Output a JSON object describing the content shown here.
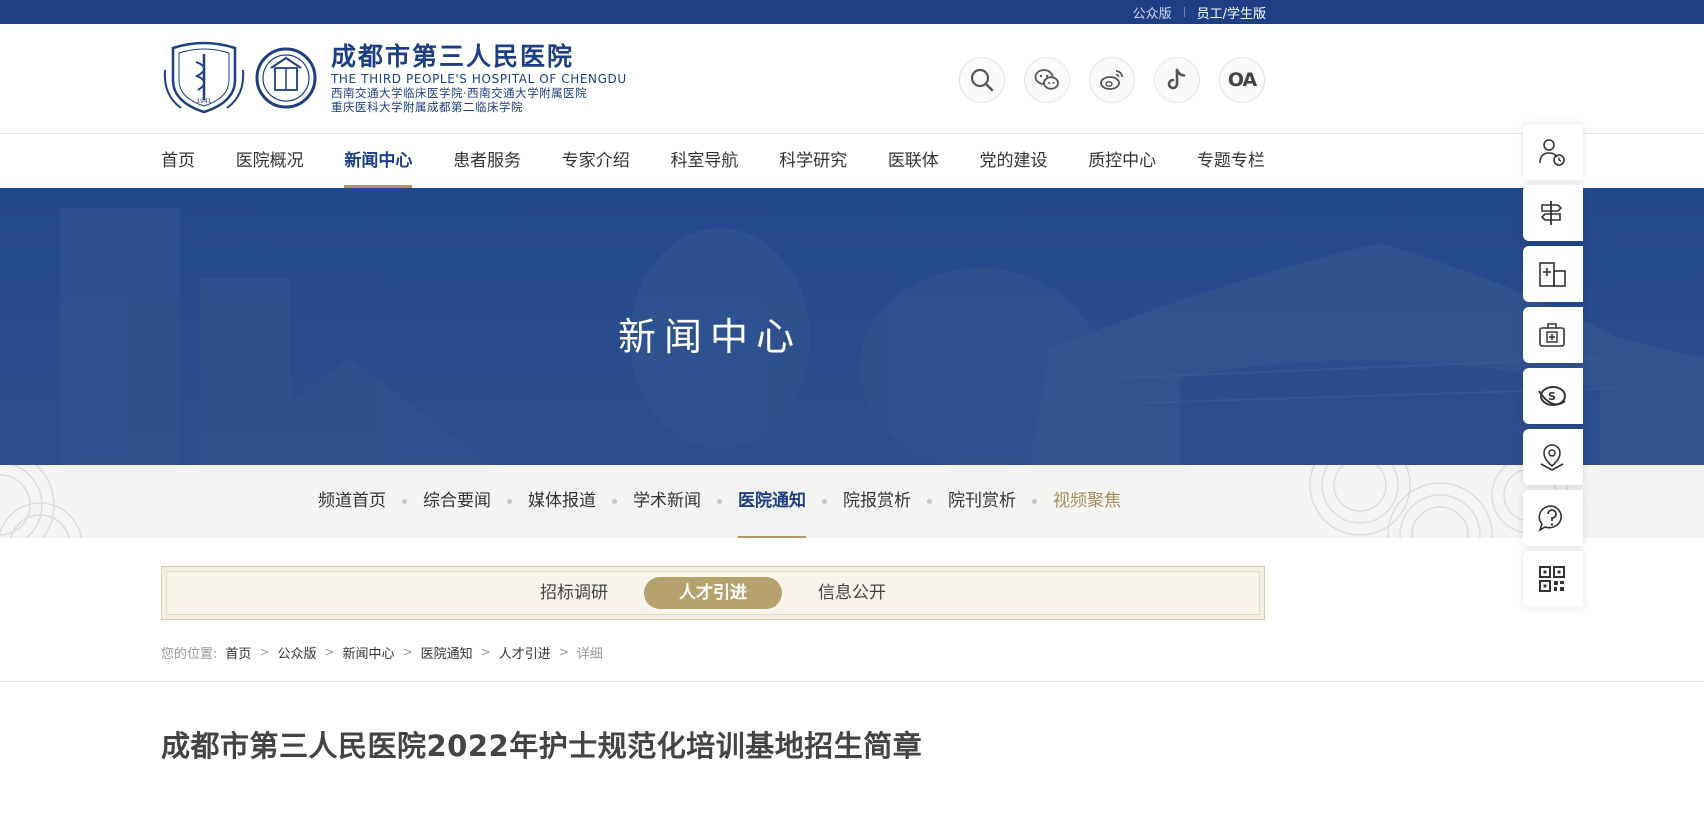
{
  "topbar": {
    "public_version": "公众版",
    "staff_version": "员工/学生版"
  },
  "logo": {
    "name_cn": "成都市第三人民医院",
    "name_en": "THE THIRD PEOPLE'S HOSPITAL OF CHENGDU",
    "affiliation_1": "西南交通大学临床医学院·西南交通大学附属医院",
    "affiliation_2": "重庆医科大学附属成都第二临床学院",
    "emblem_year": "1941"
  },
  "tools": {
    "oa_label": "OA"
  },
  "nav": {
    "items": [
      {
        "label": "首页"
      },
      {
        "label": "医院概况"
      },
      {
        "label": "新闻中心"
      },
      {
        "label": "患者服务"
      },
      {
        "label": "专家介绍"
      },
      {
        "label": "科室导航"
      },
      {
        "label": "科学研究"
      },
      {
        "label": "医联体"
      },
      {
        "label": "党的建设"
      },
      {
        "label": "质控中心"
      },
      {
        "label": "专题专栏"
      }
    ],
    "active_index": 2
  },
  "banner": {
    "title": "新闻中心"
  },
  "subnav": {
    "items": [
      {
        "label": "频道首页"
      },
      {
        "label": "综合要闻"
      },
      {
        "label": "媒体报道"
      },
      {
        "label": "学术新闻"
      },
      {
        "label": "医院通知"
      },
      {
        "label": "院报赏析"
      },
      {
        "label": "院刊赏析"
      },
      {
        "label": "视频聚焦"
      }
    ],
    "active_index": 4
  },
  "tabs": {
    "items": [
      {
        "label": "招标调研"
      },
      {
        "label": "人才引进"
      },
      {
        "label": "信息公开"
      }
    ],
    "active_index": 1
  },
  "breadcrumb": {
    "label": "您的位置:",
    "items": [
      "首页",
      "公众版",
      "新闻中心",
      "医院通知",
      "人才引进",
      "详细"
    ]
  },
  "article": {
    "title": "成都市第三人民医院2022年护士规范化培训基地招生简章"
  },
  "colors": {
    "brand_blue": "#1e3f86",
    "gold": "#b5a26d"
  }
}
